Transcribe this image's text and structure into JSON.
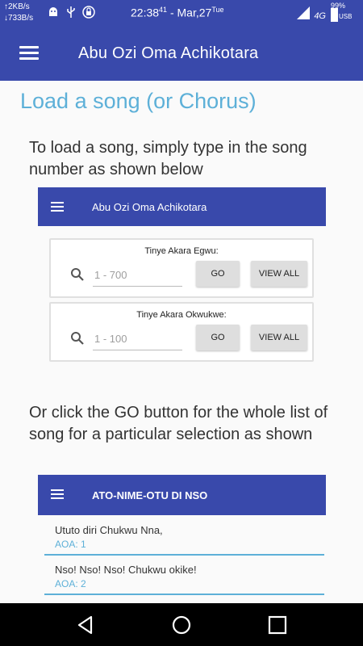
{
  "status_bar": {
    "upload_speed": "↑2KB/s",
    "download_speed": "↓733B/s",
    "time": "22:38",
    "seconds": "41",
    "date": " - Mar,27",
    "day": "Tue",
    "network": "4G",
    "battery": "99%",
    "charging": "USB"
  },
  "app_bar": {
    "title": "Abu Ozi Oma Achikotara"
  },
  "page": {
    "title": "Load a song (or Chorus)",
    "instruction_1": "To load a song, simply type in the song number as shown below",
    "instruction_2": "Or click the GO button for the whole list of song for a particular selection as shown"
  },
  "example_1": {
    "app_title": "Abu Ozi Oma Achikotara",
    "cards": [
      {
        "label": "Tinye Akara Egwu:",
        "placeholder": "1 - 700",
        "go": "GO",
        "view_all": "VIEW ALL"
      },
      {
        "label": "Tinye Akara Okwukwe:",
        "placeholder": "1 - 100",
        "go": "GO",
        "view_all": "VIEW ALL"
      }
    ]
  },
  "example_2": {
    "app_title": "ATO-NIME-OTU DI NSO",
    "items": [
      {
        "title": "Ututo diri Chukwu Nna,",
        "sub": "AOA:  1"
      },
      {
        "title": "Nso! Nso! Nso! Chukwu okike!",
        "sub": "AOA:  2"
      }
    ]
  },
  "colors": {
    "primary": "#3949ab",
    "accent": "#5db0d8",
    "background": "#fafafa"
  },
  "icons": [
    "menu-icon",
    "search-icon",
    "back-icon",
    "home-icon",
    "recent-apps-icon",
    "signal-icon",
    "android-icon",
    "usb-icon",
    "lock-icon"
  ]
}
